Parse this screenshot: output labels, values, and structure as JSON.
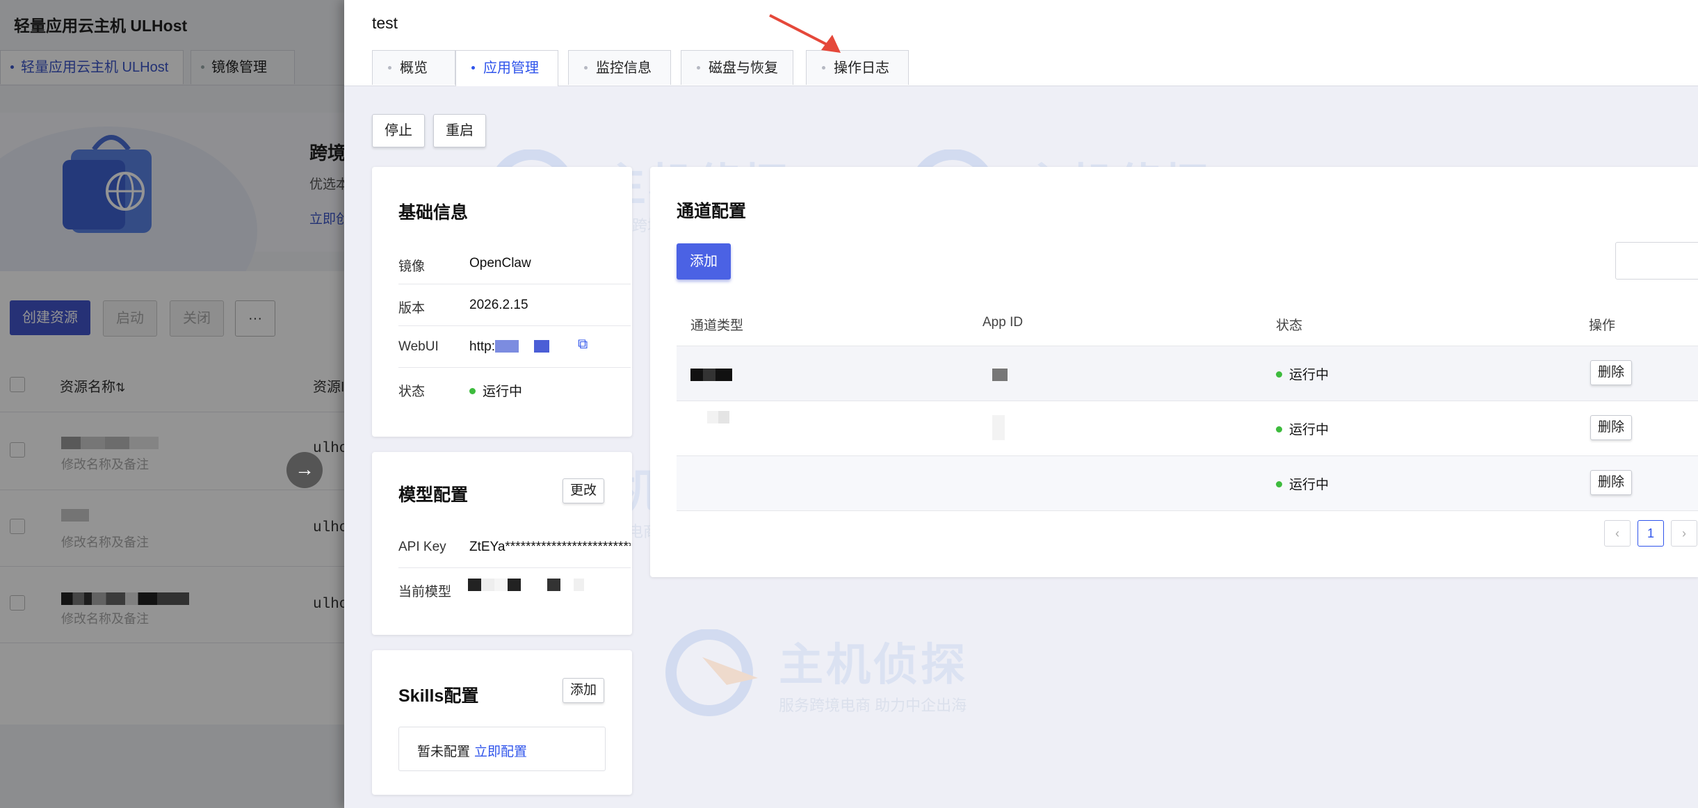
{
  "background": {
    "app_title": "轻量应用云主机 ULHost",
    "tabs": [
      "轻量应用云主机 ULHost",
      "镜像管理"
    ],
    "banner_title": "跨境",
    "banner_sub": "优选本",
    "banner_link": "立即创",
    "buttons": {
      "create": "创建资源",
      "start": "启动",
      "close": "关闭",
      "more": "···"
    },
    "columns": {
      "name": "资源名称",
      "id": "资源I"
    },
    "rows": [
      {
        "sub": "修改名称及备注",
        "host": "ulho"
      },
      {
        "sub": "修改名称及备注",
        "host": "ulho"
      },
      {
        "sub": "修改名称及备注",
        "host": "ulho"
      }
    ]
  },
  "drawer": {
    "title": "test",
    "tabs": [
      "概览",
      "应用管理",
      "监控信息",
      "磁盘与恢复",
      "操作日志"
    ],
    "active_tab": "应用管理",
    "actions": {
      "stop": "停止",
      "restart": "重启"
    },
    "basic_info": {
      "title": "基础信息",
      "rows": [
        {
          "key": "镜像",
          "value": "OpenClaw"
        },
        {
          "key": "版本",
          "value": "2026.2.15"
        },
        {
          "key": "WebUI",
          "value": "http:"
        },
        {
          "key": "状态",
          "value": "运行中"
        }
      ]
    },
    "model_config": {
      "title": "模型配置",
      "edit_label": "更改",
      "api_key_label": "API Key",
      "api_key_value": "ZtEYa***************************...",
      "model_label": "当前模型"
    },
    "skills": {
      "title": "Skills配置",
      "add_label": "添加",
      "empty_text": "暂未配置",
      "config_link": "立即配置"
    },
    "channel": {
      "title": "通道配置",
      "add_label": "添加",
      "columns": {
        "type": "通道类型",
        "app_id": "App ID",
        "status": "状态",
        "action": "操作"
      },
      "rows": [
        {
          "status": "运行中",
          "action": "删除"
        },
        {
          "status": "运行中",
          "action": "删除"
        },
        {
          "status": "运行中",
          "action": "删除"
        }
      ],
      "pagination": {
        "prev": "‹",
        "current": "1",
        "next": "›"
      }
    },
    "watermark": {
      "brand": "主机侦探",
      "slogan": "服务跨境电商  助力中企出海"
    }
  },
  "colors": {
    "accent": "#2f54eb",
    "running": "#3dbb3d",
    "primary_button": "#4b62e4",
    "annotation_arrow": "#e5483a"
  }
}
